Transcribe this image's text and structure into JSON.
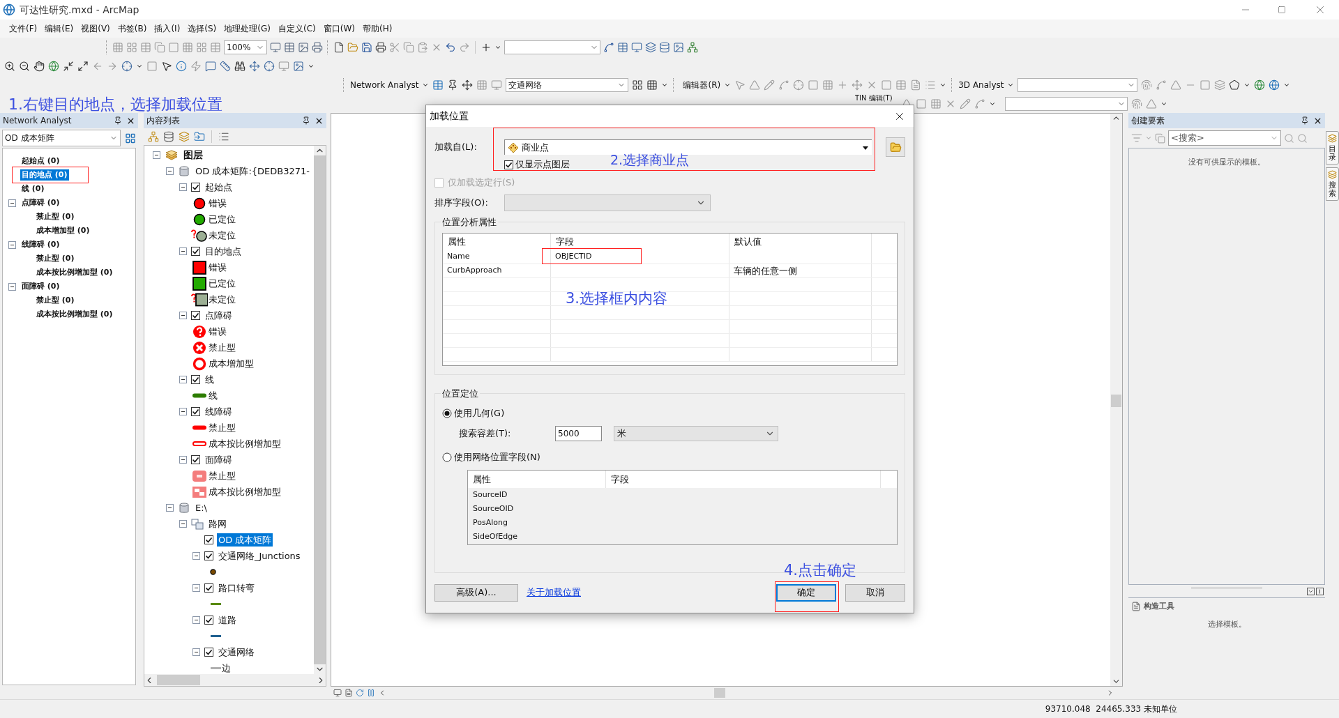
{
  "window": {
    "title": "可达性研究.mxd - ArcMap"
  },
  "menu": [
    "文件(F)",
    "编辑(E)",
    "视图(V)",
    "书签(B)",
    "插入(I)",
    "选择(S)",
    "地理处理(G)",
    "自定义(C)",
    "窗口(W)",
    "帮助(H)"
  ],
  "toolbars": {
    "zoom": "100%",
    "network_analyst": "Network Analyst",
    "network_dataset": "交通网络",
    "editor": "编辑器(R)",
    "analyst_3d": "3D Analyst",
    "tin_editor": "TIN 编辑(T)"
  },
  "annotations": [
    {
      "text": "1.右键目的地点，选择加载位置"
    },
    {
      "text": "2.选择商业点"
    },
    {
      "text": "3.选择框内内容"
    },
    {
      "text": "4.点击确定"
    }
  ],
  "network_analyst": {
    "title": "Network Analyst",
    "analysis": "OD 成本矩阵",
    "tree": [
      {
        "label": "起始点 (0)",
        "selected": false
      },
      {
        "label": "目的地点 (0)",
        "selected": true
      },
      {
        "label": "线 (0)",
        "selected": false
      },
      {
        "label": "点障碍 (0)",
        "selected": false,
        "expanded": true,
        "children": [
          {
            "label": "禁止型 (0)",
            "selected": false
          },
          {
            "label": "成本增加型 (0)",
            "selected": false
          }
        ]
      },
      {
        "label": "线障碍 (0)",
        "selected": false,
        "expanded": true,
        "children": [
          {
            "label": "禁止型 (0)",
            "selected": false
          },
          {
            "label": "成本按比例增加型 (0)",
            "selected": false
          }
        ]
      },
      {
        "label": "面障碍 (0)",
        "selected": false,
        "expanded": true,
        "children": [
          {
            "label": "禁止型 (0)",
            "selected": false
          },
          {
            "label": "成本按比例增加型 (0)",
            "selected": false
          }
        ]
      }
    ]
  },
  "contents": {
    "title": "内容列表",
    "tree": [
      {
        "kind": "layers",
        "label": "图层",
        "expanded": true,
        "selected": false,
        "children": [
          {
            "kind": "database",
            "label": "OD 成本矩阵:{DEDB3271-",
            "expanded": true,
            "selected": false,
            "children": [
              {
                "kind": "layer",
                "label": "起始点",
                "expanded": true,
                "checked": true,
                "selected": false,
                "children": [
                  {
                    "kind": "circle",
                    "color": "#ff0000",
                    "label": "错误"
                  },
                  {
                    "kind": "circle",
                    "color": "#22aa00",
                    "label": "已定位"
                  },
                  {
                    "kind": "unplacedcircle",
                    "color": "#9caf94",
                    "label": "未定位"
                  }
                ]
              },
              {
                "kind": "layer",
                "label": "目的地点",
                "expanded": true,
                "checked": true,
                "selected": false,
                "children": [
                  {
                    "kind": "square",
                    "color": "#ff0000",
                    "label": "错误"
                  },
                  {
                    "kind": "square",
                    "color": "#22aa00",
                    "label": "已定位"
                  },
                  {
                    "kind": "unplacedsquare",
                    "color": "#9caf94",
                    "label": "未定位"
                  }
                ]
              },
              {
                "kind": "layer",
                "label": "点障碍",
                "expanded": true,
                "checked": true,
                "selected": false,
                "children": [
                  {
                    "kind": "question",
                    "color": "#ff0000",
                    "label": "错误"
                  },
                  {
                    "kind": "cross",
                    "color": "#ff0000",
                    "label": "禁止型"
                  },
                  {
                    "kind": "ring",
                    "color": "#ff0000",
                    "label": "成本增加型"
                  }
                ]
              },
              {
                "kind": "layer",
                "label": "线",
                "expanded": true,
                "checked": true,
                "selected": false,
                "children": [
                  {
                    "kind": "line",
                    "color": "#2e7d00",
                    "label": "线"
                  }
                ]
              },
              {
                "kind": "layer",
                "label": "线障碍",
                "expanded": true,
                "checked": true,
                "selected": false,
                "children": [
                  {
                    "kind": "line",
                    "color": "#ff0000",
                    "label": "禁止型"
                  },
                  {
                    "kind": "hollowline",
                    "color": "#ff0000",
                    "label": "成本按比例增加型"
                  }
                ]
              },
              {
                "kind": "layer",
                "label": "面障碍",
                "expanded": true,
                "checked": true,
                "selected": false,
                "children": [
                  {
                    "kind": "polygon",
                    "color": "#f47c7c",
                    "label": "禁止型"
                  },
                  {
                    "kind": "splitpolygon",
                    "color": "#f47c7c",
                    "label": "成本按比例增加型"
                  }
                ]
              }
            ]
          },
          {
            "kind": "database",
            "label": "E:\\",
            "expanded": true,
            "selected": false,
            "children": [
              {
                "kind": "group",
                "label": "路网",
                "expanded": true,
                "selected": false,
                "children": [
                  {
                    "kind": "layer",
                    "label": "OD 成本矩阵",
                    "checked": true,
                    "selected": true
                  },
                  {
                    "kind": "layer",
                    "label": "交通网络_Junctions",
                    "expanded": true,
                    "checked": true,
                    "selected": false,
                    "children": [
                      {
                        "kind": "dot",
                        "color": "#7a4a00"
                      }
                    ]
                  },
                  {
                    "kind": "layer",
                    "label": "路口转弯",
                    "expanded": true,
                    "checked": true,
                    "selected": false,
                    "children": [
                      {
                        "kind": "stroke",
                        "color": "#5a8a00"
                      }
                    ]
                  },
                  {
                    "kind": "layer",
                    "label": "道路",
                    "expanded": true,
                    "checked": true,
                    "selected": false,
                    "children": [
                      {
                        "kind": "stroke",
                        "color": "#1f6090"
                      }
                    ]
                  },
                  {
                    "kind": "layer",
                    "label": "交通网络",
                    "expanded": true,
                    "checked": true,
                    "selected": false,
                    "children": [
                      {
                        "kind": "stroke",
                        "color": "#b0b0b0",
                        "label": "边"
                      }
                    ]
                  }
                ]
              }
            ]
          }
        ]
      }
    ]
  },
  "dialog": {
    "title": "加载位置",
    "load_from_label": "加载自(L):",
    "load_from": "商业点",
    "only_points": {
      "label": "仅显示点图层",
      "checked": true
    },
    "only_selected": {
      "label": "仅加载选定行(S)",
      "checked": false,
      "disabled": true
    },
    "sort_label": "排序字段(O):",
    "properties_group": "位置分析属性",
    "properties_columns": [
      "属性",
      "字段",
      "默认值"
    ],
    "properties_rows": [
      {
        "property": "Name",
        "field": "OBJECTID"
      },
      {
        "property": "CurbApproach",
        "default": "车辆的任意一侧"
      }
    ],
    "position_group": "位置定位",
    "geometry": {
      "label": "使用几何(G)",
      "selected": true
    },
    "tolerance_label": "搜索容差(T):",
    "tolerance": "5000",
    "unit": "米",
    "network_fields": {
      "label": "使用网络位置字段(N)",
      "selected": false
    },
    "network_columns": [
      "属性",
      "字段"
    ],
    "network_rows": [
      "SourceID",
      "SourceOID",
      "PosAlong",
      "SideOfEdge"
    ],
    "advanced": "高级(A)...",
    "about_link": "关于加载位置",
    "ok": "确定",
    "cancel": "取消"
  },
  "create_features": {
    "title": "创建要素",
    "search_placeholder": "<搜索>",
    "empty_message": "没有可供显示的模板。",
    "tools_title": "构造工具",
    "tools_message": "选择模板。"
  },
  "side_tabs": [
    "目录",
    "搜索"
  ],
  "status_bar": {
    "coordinates": "93710.048  24465.333 未知单位"
  }
}
